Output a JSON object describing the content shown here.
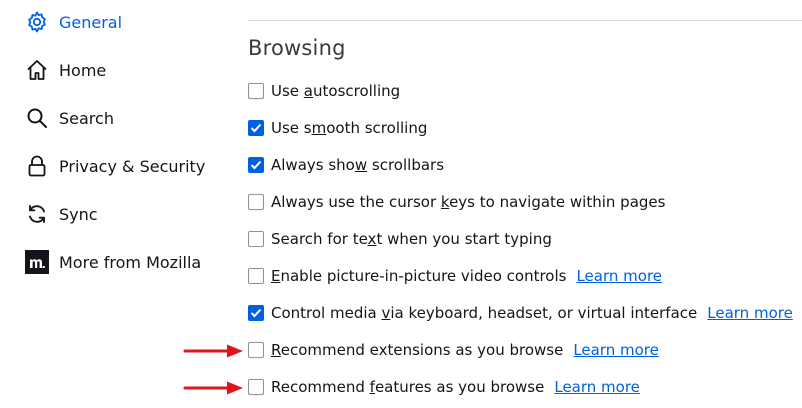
{
  "colors": {
    "accent": "#0061e0",
    "arrow": "#e0141b"
  },
  "sidebar": {
    "items": [
      {
        "label": "General",
        "icon": "gear-icon",
        "active": true
      },
      {
        "label": "Home",
        "icon": "home-icon"
      },
      {
        "label": "Search",
        "icon": "search-icon"
      },
      {
        "label": "Privacy & Security",
        "icon": "lock-icon"
      },
      {
        "label": "Sync",
        "icon": "sync-icon"
      },
      {
        "label": "More from Mozilla",
        "icon": "mozilla-logo-icon"
      }
    ]
  },
  "browsing": {
    "title": "Browsing",
    "learn_more": "Learn more",
    "options": [
      {
        "pre": "Use ",
        "key": "a",
        "post": "utoscrolling",
        "checked": false
      },
      {
        "pre": "Use s",
        "key": "m",
        "post": "ooth scrolling",
        "checked": true
      },
      {
        "pre": "Always sho",
        "key": "w",
        "post": " scrollbars",
        "checked": true
      },
      {
        "pre": "Always use the cursor ",
        "key": "k",
        "post": "eys to navigate within pages",
        "checked": false
      },
      {
        "pre": "Search for te",
        "key": "x",
        "post": "t when you start typing",
        "checked": false
      },
      {
        "pre": "",
        "key": "E",
        "post": "nable picture-in-picture video controls",
        "checked": false,
        "learn_more": true
      },
      {
        "pre": "Control media ",
        "key": "v",
        "post": "ia keyboard, headset, or virtual interface",
        "checked": true,
        "learn_more": true
      },
      {
        "pre": "",
        "key": "R",
        "post": "ecommend extensions as you browse",
        "checked": false,
        "learn_more": true
      },
      {
        "pre": "Recommend ",
        "key": "f",
        "post": "eatures as you browse",
        "checked": false,
        "learn_more": true
      }
    ]
  }
}
